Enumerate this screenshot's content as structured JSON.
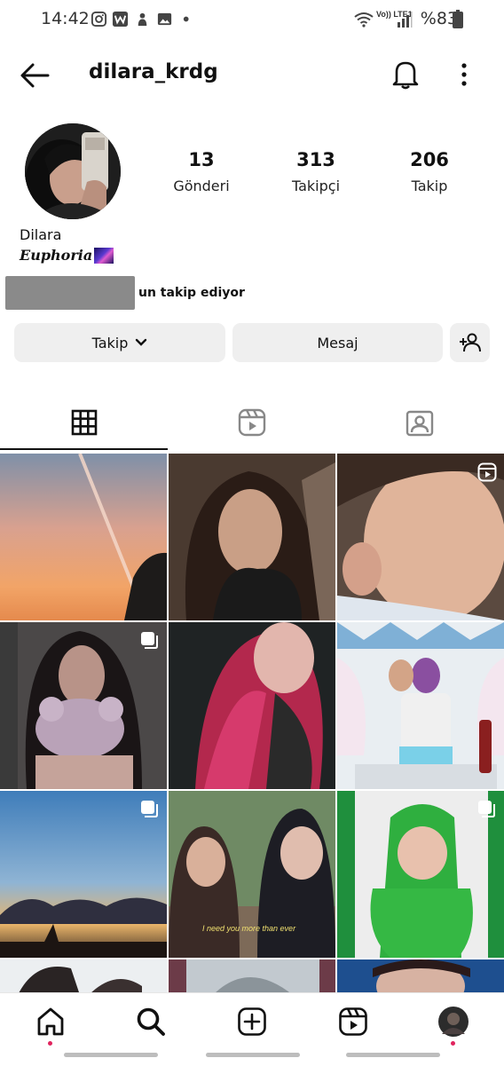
{
  "status_bar": {
    "time": "14:42",
    "right_text": "%83",
    "network": "Vo)) LTE1",
    "icons": [
      "instagram-icon",
      "w-icon",
      "notification-icon",
      "gallery-icon",
      "dot-icon",
      "wifi-icon",
      "signal-icon",
      "battery-icon"
    ]
  },
  "header": {
    "username": "dilara_krdg",
    "icons": [
      "back-arrow-icon",
      "bell-icon",
      "more-vertical-icon"
    ]
  },
  "profile": {
    "stats": [
      {
        "value": "13",
        "label": "Gönderi"
      },
      {
        "value": "313",
        "label": "Takipçi"
      },
      {
        "value": "206",
        "label": "Takip"
      }
    ],
    "name": "Dilara",
    "bio": "Euphoria",
    "mutual_text": "un takip ediyor"
  },
  "actions": {
    "follow_label": "Takip",
    "message_label": "Mesaj"
  },
  "tabs": [
    {
      "name": "posts-grid",
      "icon": "grid-icon",
      "active": true
    },
    {
      "name": "reels",
      "icon": "reels-icon",
      "active": false
    },
    {
      "name": "tagged",
      "icon": "tagged-icon",
      "active": false
    }
  ],
  "grid": [
    {
      "subject": "sunset sky with contrail",
      "badge": "multi"
    },
    {
      "subject": "selfie woman",
      "badge": "none"
    },
    {
      "subject": "baby closeup",
      "badge": "reel"
    },
    {
      "subject": "girl with plush toy",
      "badge": "multi"
    },
    {
      "subject": "pink hair selfie",
      "badge": "none"
    },
    {
      "subject": "birthday party",
      "badge": "none"
    },
    {
      "subject": "sunset clouds",
      "badge": "multi"
    },
    {
      "subject": "two girls selfie",
      "badge": "none"
    },
    {
      "subject": "baby in green costume",
      "badge": "multi"
    }
  ],
  "grid_caption": "I need you more than ever",
  "bottom_nav": [
    "home-icon",
    "search-icon",
    "create-icon",
    "reels-icon",
    "profile-avatar"
  ],
  "colors": {
    "accent": "#e0245e",
    "button_bg": "#efefef",
    "text": "#111111"
  }
}
